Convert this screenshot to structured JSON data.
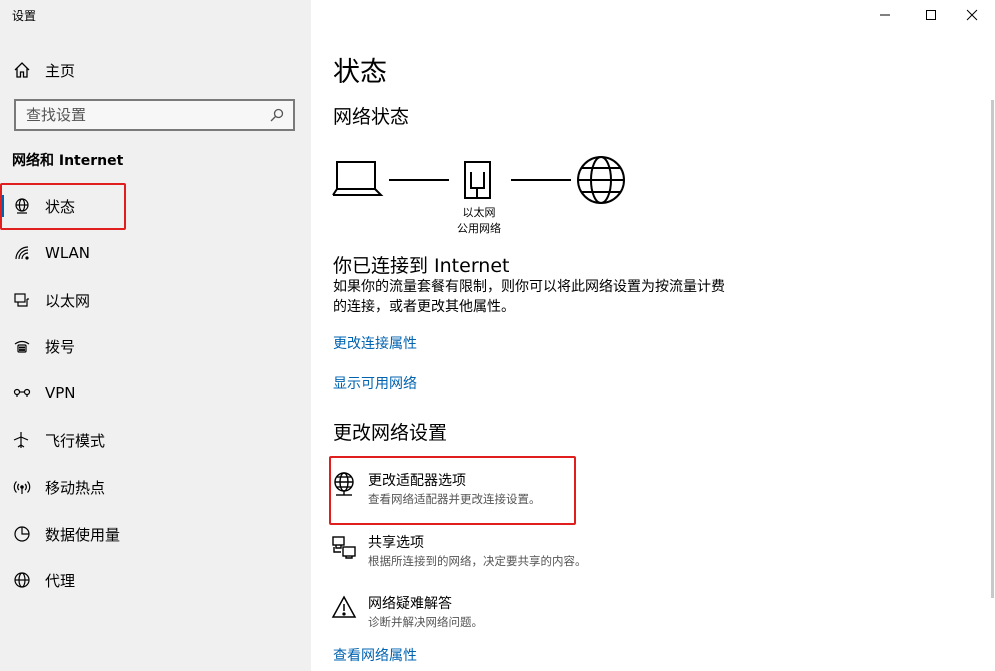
{
  "window": {
    "title": "设置",
    "controls": [
      "minimize",
      "maximize",
      "close"
    ]
  },
  "sidebar": {
    "home_label": "主页",
    "search_placeholder": "查找设置",
    "section_title": "网络和 Internet",
    "items": [
      {
        "label": "状态",
        "icon": "globe-icon",
        "active": true
      },
      {
        "label": "WLAN",
        "icon": "wifi-icon"
      },
      {
        "label": "以太网",
        "icon": "ethernet-icon"
      },
      {
        "label": "拨号",
        "icon": "dialup-icon"
      },
      {
        "label": "VPN",
        "icon": "vpn-icon"
      },
      {
        "label": "飞行模式",
        "icon": "airplane-icon"
      },
      {
        "label": "移动热点",
        "icon": "hotspot-icon"
      },
      {
        "label": "数据使用量",
        "icon": "data-usage-icon"
      },
      {
        "label": "代理",
        "icon": "globe-icon"
      }
    ]
  },
  "main": {
    "page_title": "状态",
    "network_status_heading": "网络状态",
    "ethernet_caption": {
      "line1": "以太网",
      "line2": "公用网络"
    },
    "connected_title": "你已连接到 Internet",
    "connected_desc": "如果你的流量套餐有限制，则你可以将此网络设置为按流量计费的连接，或者更改其他属性。",
    "links": {
      "change_properties": "更改连接属性",
      "show_networks": "显示可用网络",
      "view_properties": "查看网络属性"
    },
    "change_settings_heading": "更改网络设置",
    "options": [
      {
        "title": "更改适配器选项",
        "desc": "查看网络适配器并更改连接设置。",
        "icon": "adapter-icon"
      },
      {
        "title": "共享选项",
        "desc": "根据所连接到的网络，决定要共享的内容。",
        "icon": "sharing-icon"
      },
      {
        "title": "网络疑难解答",
        "desc": "诊断并解决网络问题。",
        "icon": "warning-icon"
      }
    ]
  },
  "colors": {
    "accent": "#0063b1",
    "highlight": "#e01e1e",
    "sidebar_bg": "#f0f0f0"
  }
}
